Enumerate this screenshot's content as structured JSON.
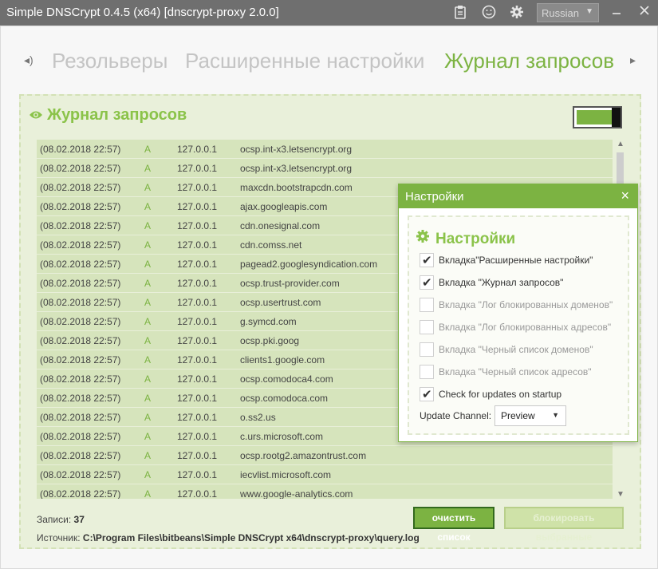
{
  "window": {
    "title": "Simple DNSCrypt 0.4.5 (x64) [dnscrypt-proxy 2.0.0]",
    "language": "Russian",
    "icons": [
      "clipboard-icon",
      "smiley-icon",
      "gear-icon",
      "minimize-icon",
      "close-icon"
    ]
  },
  "tabs": [
    {
      "label": "Резольверы",
      "active": false
    },
    {
      "label": "Расширенные настройки",
      "active": false
    },
    {
      "label": "Журнал запросов",
      "active": true
    }
  ],
  "panel": {
    "title": "Журнал запросов",
    "toggle_on": true,
    "accent_color": "#7cb342"
  },
  "log": [
    {
      "time": "(08.02.2018 22:57)",
      "type": "A",
      "ip": "127.0.0.1",
      "host": "ocsp.int-x3.letsencrypt.org"
    },
    {
      "time": "(08.02.2018 22:57)",
      "type": "A",
      "ip": "127.0.0.1",
      "host": "ocsp.int-x3.letsencrypt.org"
    },
    {
      "time": "(08.02.2018 22:57)",
      "type": "A",
      "ip": "127.0.0.1",
      "host": "maxcdn.bootstrapcdn.com"
    },
    {
      "time": "(08.02.2018 22:57)",
      "type": "A",
      "ip": "127.0.0.1",
      "host": "ajax.googleapis.com"
    },
    {
      "time": "(08.02.2018 22:57)",
      "type": "A",
      "ip": "127.0.0.1",
      "host": "cdn.onesignal.com"
    },
    {
      "time": "(08.02.2018 22:57)",
      "type": "A",
      "ip": "127.0.0.1",
      "host": "cdn.comss.net"
    },
    {
      "time": "(08.02.2018 22:57)",
      "type": "A",
      "ip": "127.0.0.1",
      "host": "pagead2.googlesyndication.com"
    },
    {
      "time": "(08.02.2018 22:57)",
      "type": "A",
      "ip": "127.0.0.1",
      "host": "ocsp.trust-provider.com"
    },
    {
      "time": "(08.02.2018 22:57)",
      "type": "A",
      "ip": "127.0.0.1",
      "host": "ocsp.usertrust.com"
    },
    {
      "time": "(08.02.2018 22:57)",
      "type": "A",
      "ip": "127.0.0.1",
      "host": "g.symcd.com"
    },
    {
      "time": "(08.02.2018 22:57)",
      "type": "A",
      "ip": "127.0.0.1",
      "host": "ocsp.pki.goog"
    },
    {
      "time": "(08.02.2018 22:57)",
      "type": "A",
      "ip": "127.0.0.1",
      "host": "clients1.google.com"
    },
    {
      "time": "(08.02.2018 22:57)",
      "type": "A",
      "ip": "127.0.0.1",
      "host": "ocsp.comodoca4.com"
    },
    {
      "time": "(08.02.2018 22:57)",
      "type": "A",
      "ip": "127.0.0.1",
      "host": "ocsp.comodoca.com"
    },
    {
      "time": "(08.02.2018 22:57)",
      "type": "A",
      "ip": "127.0.0.1",
      "host": "o.ss2.us"
    },
    {
      "time": "(08.02.2018 22:57)",
      "type": "A",
      "ip": "127.0.0.1",
      "host": "c.urs.microsoft.com"
    },
    {
      "time": "(08.02.2018 22:57)",
      "type": "A",
      "ip": "127.0.0.1",
      "host": "ocsp.rootg2.amazontrust.com"
    },
    {
      "time": "(08.02.2018 22:57)",
      "type": "A",
      "ip": "127.0.0.1",
      "host": "iecvlist.microsoft.com"
    },
    {
      "time": "(08.02.2018 22:57)",
      "type": "A",
      "ip": "127.0.0.1",
      "host": "www.google-analytics.com"
    }
  ],
  "footer": {
    "count_label": "Записи:",
    "count_value": "37",
    "source_label": "Источник:",
    "source_path": "C:\\Program Files\\bitbeans\\Simple DNSCrypt x64\\dnscrypt-proxy\\query.log",
    "clear_button": "очистить список",
    "block_button": "блокировать выбранные"
  },
  "settings_dialog": {
    "title": "Настройки",
    "heading": "Настройки",
    "options": [
      {
        "label": "Вкладка\"Расширенные настройки\"",
        "checked": true,
        "enabled": true
      },
      {
        "label": "Вкладка \"Журнал запросов\"",
        "checked": true,
        "enabled": true
      },
      {
        "label": "Вкладка \"Лог блокированных доменов\"",
        "checked": false,
        "enabled": false
      },
      {
        "label": "Вкладка \"Лог блокированных адресов\"",
        "checked": false,
        "enabled": false
      },
      {
        "label": "Вкладка \"Черный список доменов\"",
        "checked": false,
        "enabled": false
      },
      {
        "label": "Вкладка \"Черный список адресов\"",
        "checked": false,
        "enabled": false
      },
      {
        "label": "Check for updates on startup",
        "checked": true,
        "enabled": true
      }
    ],
    "update_channel_label": "Update Channel:",
    "update_channel_value": "Preview"
  }
}
